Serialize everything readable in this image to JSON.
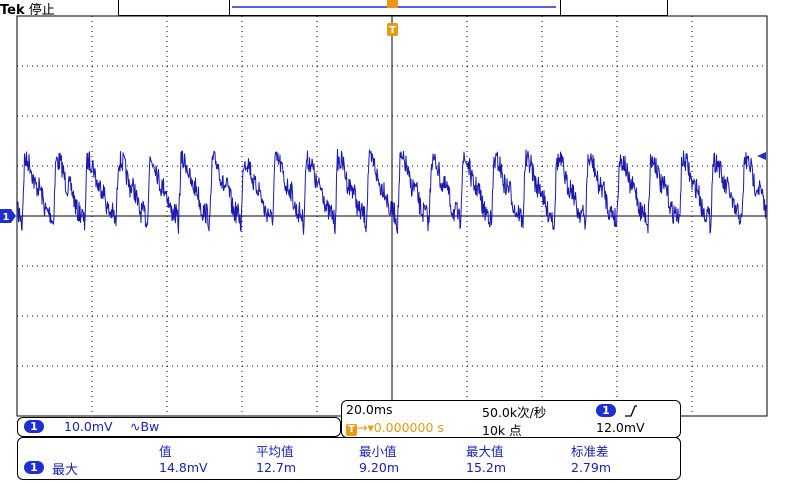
{
  "header": {
    "brand": "Tek",
    "status": "停止"
  },
  "channel": {
    "number": "1",
    "scale": "10.0mV",
    "bandwidth_icon": "∿Bw"
  },
  "timebase": {
    "time_div": "20.0ms",
    "sample_rate": "50.0k次/秒",
    "trigger_position": "0.000000 s",
    "record_length": "10k 点",
    "trigger_channel": "1",
    "trigger_slope_icon": "rising-edge-icon",
    "trigger_level": "12.0mV"
  },
  "measurements": {
    "channel": "1",
    "name": "最大",
    "headers": [
      "值",
      "平均值",
      "最小值",
      "最大值",
      "标准差"
    ],
    "values": [
      "14.8mV",
      "12.7m",
      "9.20m",
      "15.2m",
      "2.79m"
    ]
  },
  "markers": {
    "trigger_marker": "T",
    "channel_marker": "1"
  },
  "colors": {
    "trace": "#1a1ab0",
    "trigger": "#e89a12",
    "channel": "#1d2fd0"
  }
}
